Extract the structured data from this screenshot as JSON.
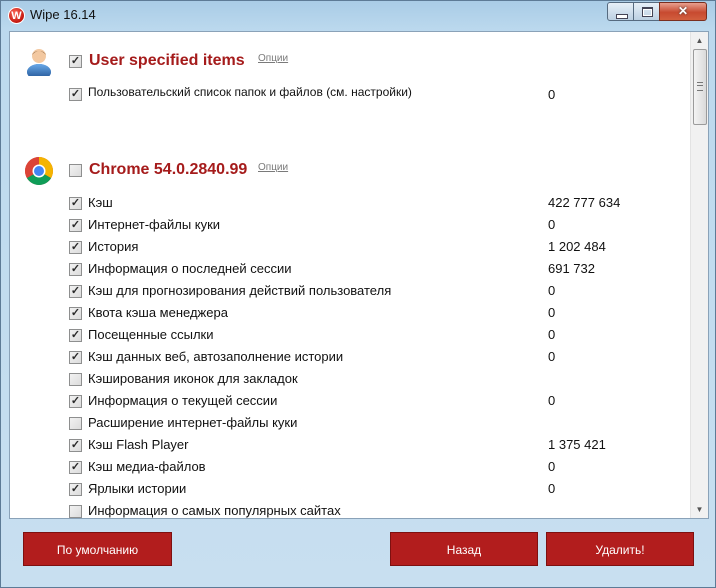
{
  "window": {
    "title": "Wipe 16.14"
  },
  "groups": [
    {
      "title": "User specified items",
      "options": "Опции",
      "checked": true,
      "icon": "user-icon",
      "items": [
        {
          "label": "Пользовательский список папок и файлов (см. настройки)",
          "value": "0",
          "checked": true
        }
      ]
    },
    {
      "title": "Chrome 54.0.2840.99",
      "options": "Опции",
      "checked": false,
      "icon": "chrome-icon",
      "items": [
        {
          "label": "Кэш",
          "value": "422 777 634",
          "checked": true
        },
        {
          "label": "Интернет-файлы куки",
          "value": "0",
          "checked": true
        },
        {
          "label": "История",
          "value": "1 202 484",
          "checked": true
        },
        {
          "label": "Информация о последней сессии",
          "value": "691 732",
          "checked": true
        },
        {
          "label": "Кэш для прогнозирования действий пользователя",
          "value": "0",
          "checked": true
        },
        {
          "label": "Квота кэша менеджера",
          "value": "0",
          "checked": true
        },
        {
          "label": "Посещенные ссылки",
          "value": "0",
          "checked": true
        },
        {
          "label": "Кэш данных веб, автозаполнение истории",
          "value": "0",
          "checked": true
        },
        {
          "label": "Кэширования иконок для закладок",
          "value": "",
          "checked": false
        },
        {
          "label": "Информация о текущей сессии",
          "value": "0",
          "checked": true
        },
        {
          "label": "Расширение интернет-файлы куки",
          "value": "",
          "checked": false
        },
        {
          "label": "Кэш Flash Player",
          "value": "1 375 421",
          "checked": true
        },
        {
          "label": "Кэш медиа-файлов",
          "value": "0",
          "checked": true
        },
        {
          "label": "Ярлыки истории",
          "value": "0",
          "checked": true
        },
        {
          "label": "Информация о самых популярных сайтах",
          "value": "",
          "checked": false
        }
      ]
    }
  ],
  "buttons": {
    "default": "По умолчанию",
    "back": "Назад",
    "delete": "Удалить!"
  },
  "colors": {
    "accent": "#b21d1d",
    "group_title": "#a51b1b"
  }
}
